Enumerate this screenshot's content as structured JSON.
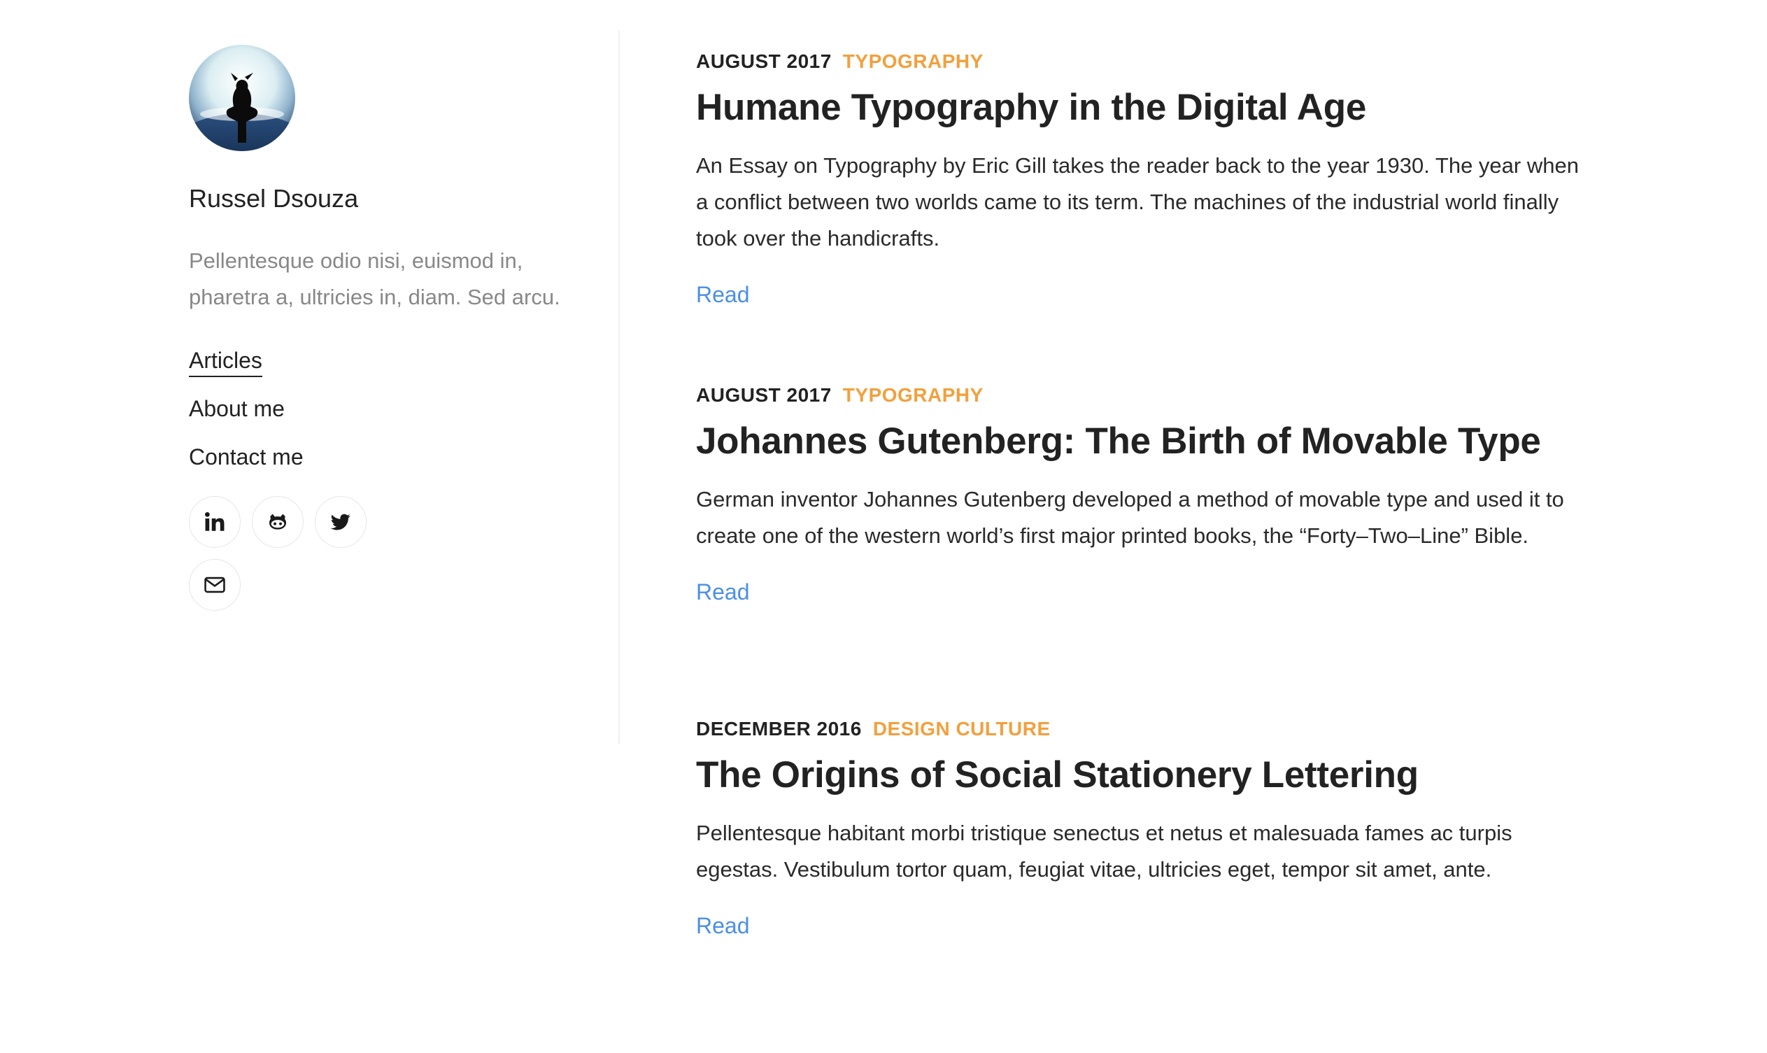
{
  "author": {
    "name": "Russel Dsouza",
    "bio": "Pellentesque odio nisi, euismod in, pharetra a, ultricies in, diam. Sed arcu."
  },
  "nav": {
    "items": [
      {
        "label": "Articles",
        "active": true
      },
      {
        "label": "About me",
        "active": false
      },
      {
        "label": "Contact me",
        "active": false
      }
    ]
  },
  "socials": [
    {
      "icon": "linkedin-icon"
    },
    {
      "icon": "github-icon"
    },
    {
      "icon": "twitter-icon"
    },
    {
      "icon": "mail-icon"
    }
  ],
  "articles": [
    {
      "date": "AUGUST 2017",
      "category": "TYPOGRAPHY",
      "title": "Humane Typography in the Digital Age",
      "excerpt": "An Essay on Typography by Eric Gill takes the reader back to the year 1930. The year when a conflict between two worlds came to its term. The machines of the industrial world finally took over the handicrafts.",
      "read_label": "Read"
    },
    {
      "date": "AUGUST 2017",
      "category": "TYPOGRAPHY",
      "title": "Johannes Gutenberg: The Birth of Movable Type",
      "excerpt": "German inventor Johannes Gutenberg developed a method of movable type and used it to create one of the western world’s first major printed books, the “Forty–Two–Line” Bible.",
      "read_label": "Read"
    },
    {
      "date": "DECEMBER 2016",
      "category": "DESIGN CULTURE",
      "title": "The Origins of Social Stationery Lettering",
      "excerpt": "Pellentesque habitant morbi tristique senectus et netus et malesuada fames ac turpis egestas. Vestibulum tortor quam, feugiat vitae, ultricies eget, tempor sit amet, ante.",
      "read_label": "Read"
    }
  ],
  "colors": {
    "accent_category": "#f2a03d",
    "link": "#4a8fe7",
    "text": "#222222",
    "muted": "#888888"
  }
}
